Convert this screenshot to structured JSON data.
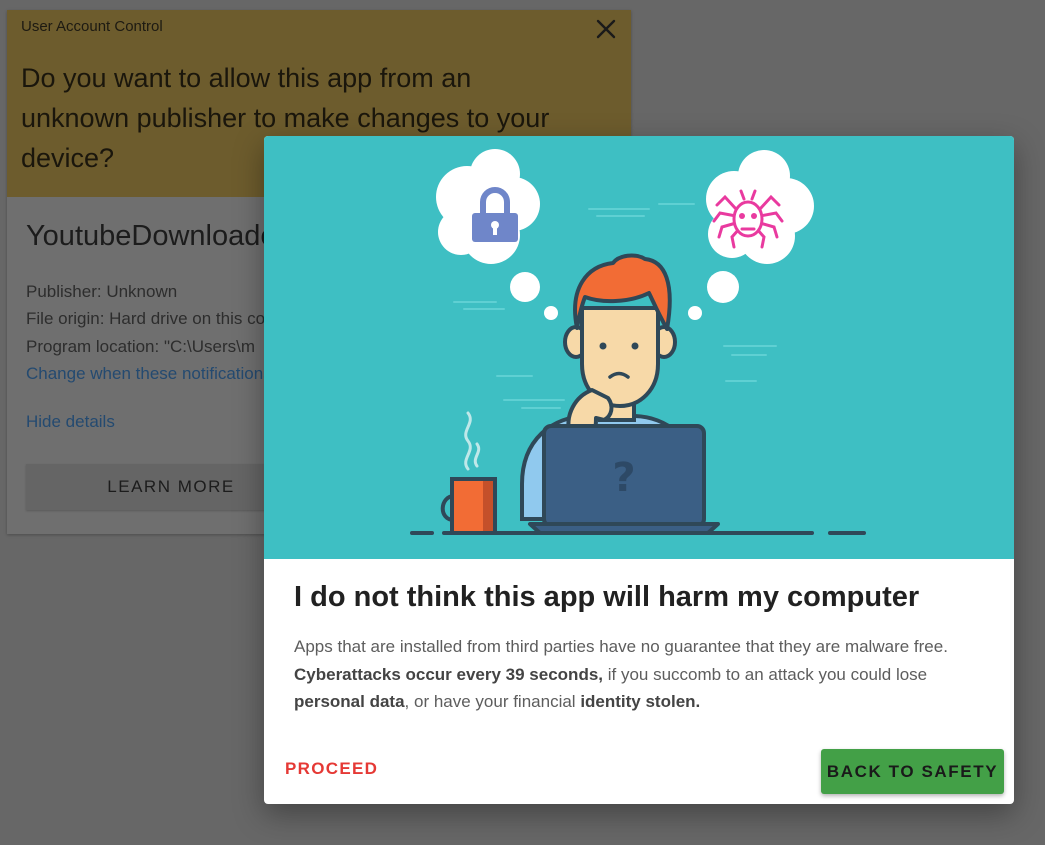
{
  "uac": {
    "caption": "User Account Control",
    "close_icon": "close-icon",
    "question": "Do you want to allow this app from an unknown publisher to make changes to your device?",
    "app_name": "YoutubeDownloader",
    "publisher": "Publisher: Unknown",
    "file_origin": "File origin: Hard drive on this computer",
    "program_location": "Program location: \"C:\\Users\\m",
    "change_link": "Change when these notifications appear",
    "hide_details": "Hide details",
    "learn_more": "LEARN MORE"
  },
  "modal": {
    "illustration": {
      "icons": [
        "lock-icon",
        "spider-icon",
        "laptop-icon",
        "coffee-mug-icon"
      ],
      "laptop_symbol": "?",
      "background_color": "#3ebfc3"
    },
    "title": "I do not think this app will harm my computer",
    "body": {
      "p1": "Apps that are installed from third parties have no guarantee that they are malware free.",
      "b1": "Cyberattacks occur every 39 seconds,",
      "p2": " if you succomb to an attack you could lose",
      "b2": "personal data",
      "p3": ", or have your financial ",
      "b3": "identity stolen."
    },
    "proceed_label": "PROCEED",
    "back_label": "BACK TO SAFETY"
  },
  "colors": {
    "uac_header": "#6d5c2d",
    "danger": "#e53935",
    "safe": "#43a047",
    "teal": "#3ebfc3"
  }
}
